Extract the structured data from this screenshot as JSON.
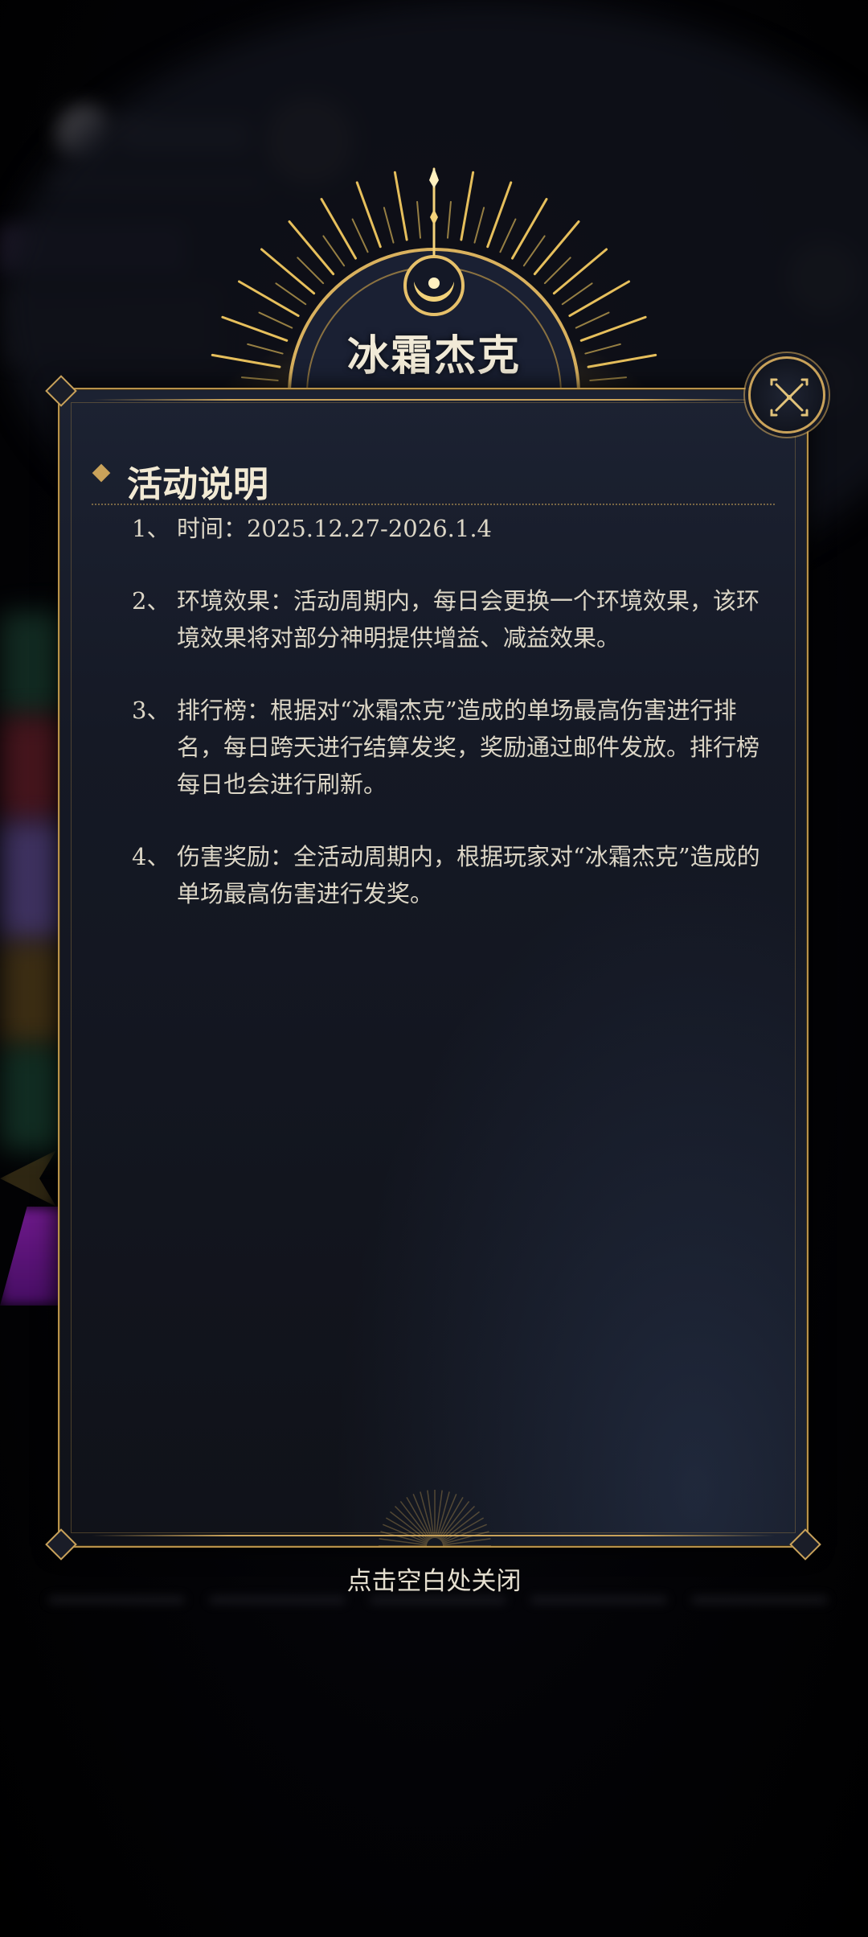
{
  "event_title": "冰霜杰克",
  "section_title": "活动说明",
  "rules": [
    {
      "num": "1、",
      "text": "时间：2025.12.27-2026.1.4"
    },
    {
      "num": "2、",
      "text": "环境效果：活动周期内，每日会更换一个环境效果，该环境效果将对部分神明提供增益、减益效果。"
    },
    {
      "num": "3、",
      "text": "排行榜：根据对“冰霜杰克”造成的单场最高伤害进行排名，每日跨天进行结算发奖，奖励通过邮件发放。排行榜每日也会进行刷新。"
    },
    {
      "num": "4、",
      "text": "伤害奖励：全活动周期内，根据玩家对“冰霜杰克”造成的单场最高伤害进行发奖。"
    }
  ],
  "close_hint": "点击空白处关闭",
  "close_icon": "close-cross-icon",
  "colors": {
    "gold_accent": "#c9a25a",
    "panel_bg": "#151925",
    "text": "#dcd6c6",
    "title_text": "#f2ead4"
  }
}
